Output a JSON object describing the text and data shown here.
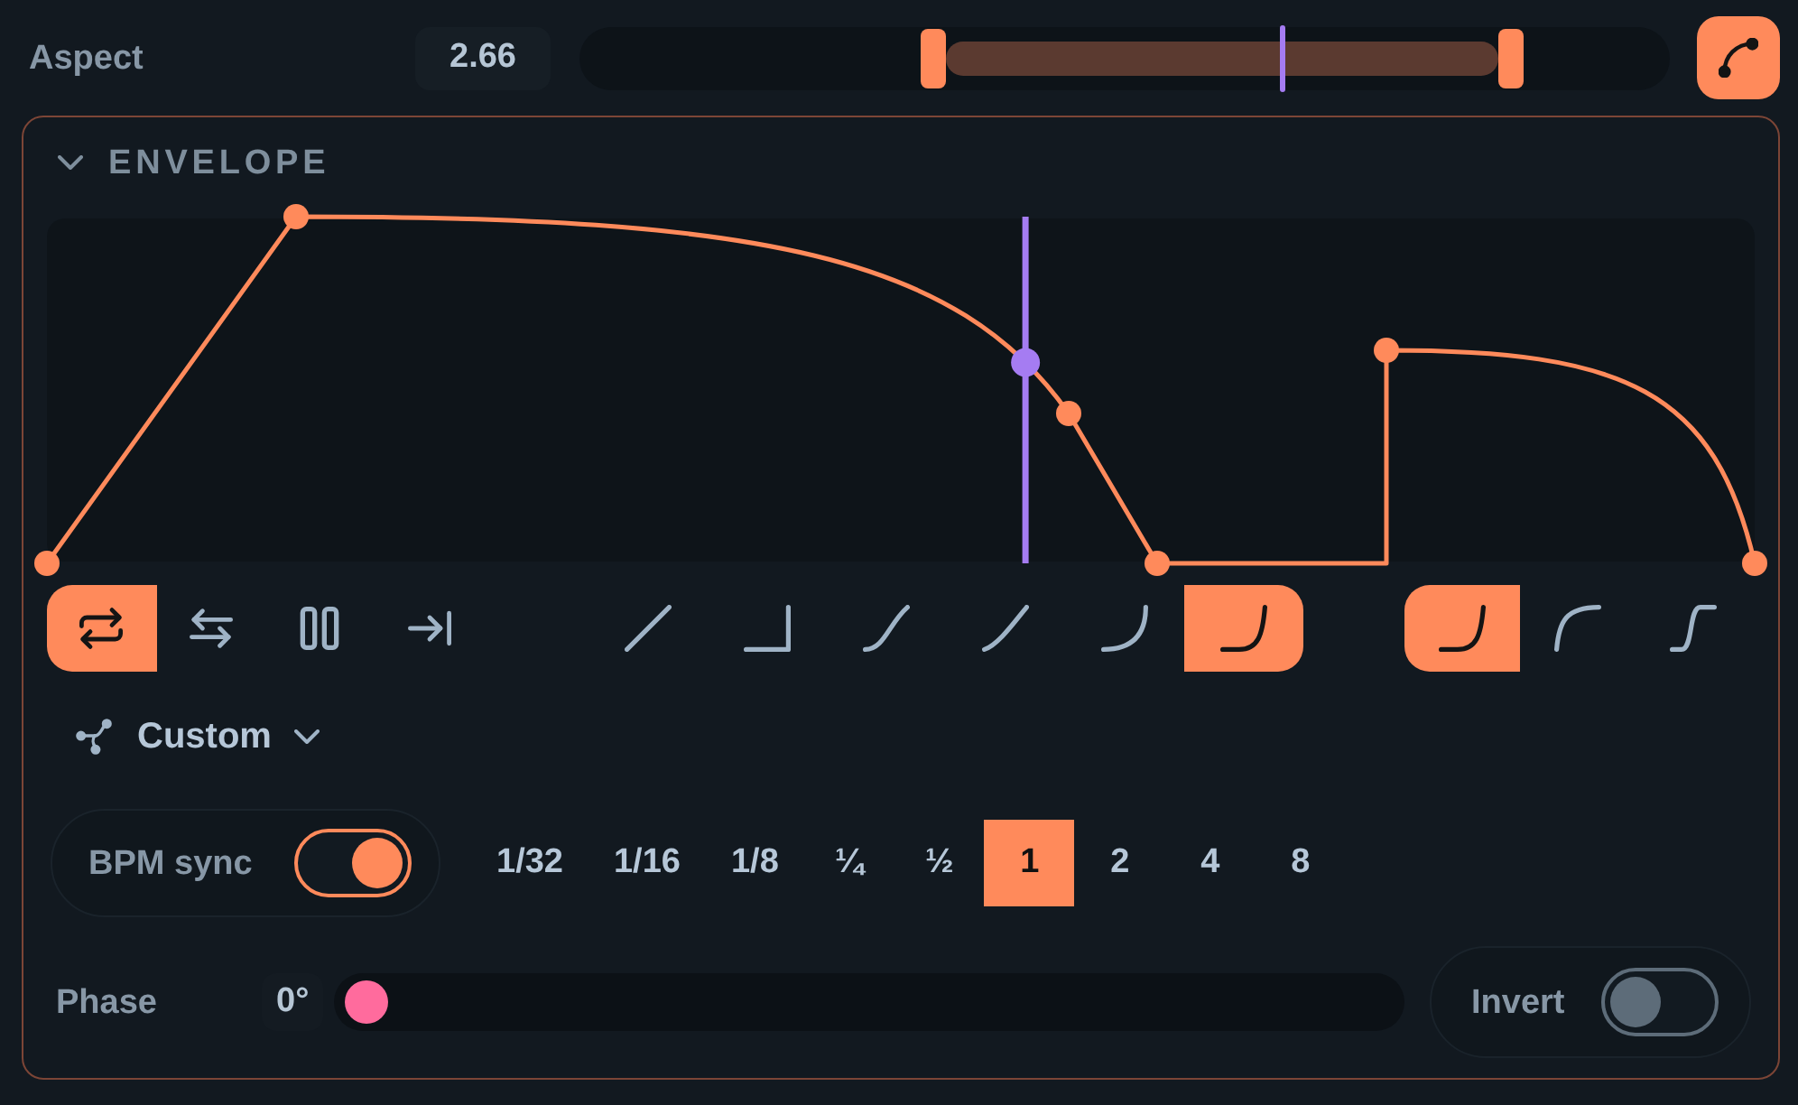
{
  "aspect": {
    "label": "Aspect",
    "value": "2.66",
    "range": {
      "low": {
        "level": 0.324
      },
      "high": {
        "level": 0.855
      }
    },
    "marker": {
      "level": 0.645
    }
  },
  "curve_button": {
    "on": true
  },
  "envelope": {
    "title": "ENVELOPE",
    "expanded": true,
    "playhead": {
      "level": 0.573
    },
    "loop_modes": [
      {
        "kind": "loop",
        "selected": true
      },
      {
        "kind": "pingpong",
        "selected": false
      },
      {
        "kind": "hold",
        "selected": false
      },
      {
        "kind": "oneshot",
        "selected": false
      }
    ],
    "segment_shapes": [
      {
        "kind": "linear",
        "selected": false
      },
      {
        "kind": "step",
        "selected": false
      },
      {
        "kind": "soft",
        "selected": false
      },
      {
        "kind": "smooth",
        "selected": false
      },
      {
        "kind": "bend",
        "selected": false
      },
      {
        "kind": "expin",
        "selected": true
      }
    ],
    "curve_types": [
      {
        "kind": "expin",
        "selected": true
      },
      {
        "kind": "expout",
        "selected": false
      },
      {
        "kind": "scurve",
        "selected": false
      }
    ],
    "preset": {
      "label": "Custom"
    },
    "bpm_sync": {
      "label": "BPM sync",
      "on": true
    },
    "divisions": [
      {
        "label": "1/32",
        "selected": false
      },
      {
        "label": "1/16",
        "selected": false
      },
      {
        "label": "1/8",
        "selected": false
      },
      {
        "label": "¼",
        "selected": false
      },
      {
        "label": "½",
        "selected": false
      },
      {
        "label": "1",
        "selected": true
      },
      {
        "label": "2",
        "selected": false
      },
      {
        "label": "4",
        "selected": false
      },
      {
        "label": "8",
        "selected": false
      }
    ],
    "phase": {
      "label": "Phase",
      "value": "0°",
      "level": 0
    },
    "invert": {
      "label": "Invert",
      "on": false
    }
  }
}
